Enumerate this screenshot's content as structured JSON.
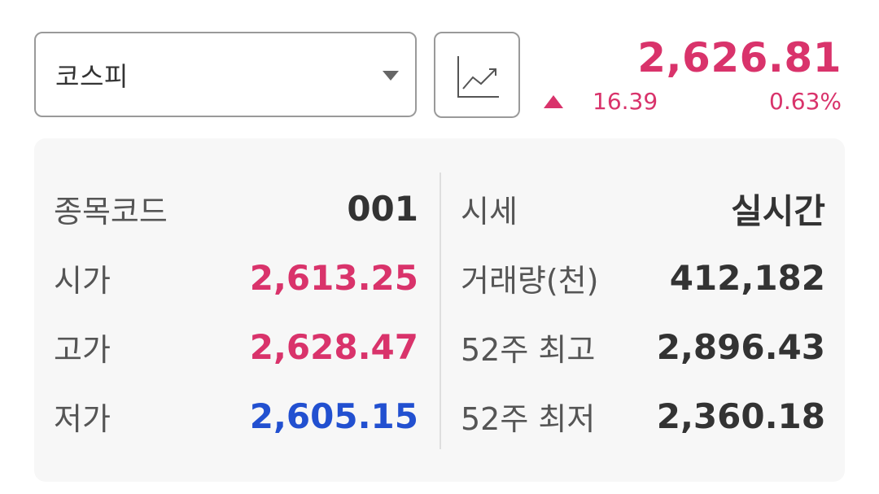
{
  "selector": {
    "selected": "코스피",
    "caret_icon": "caret-down-icon"
  },
  "chart_button": {
    "icon": "line-chart-icon"
  },
  "quote": {
    "price": "2,626.81",
    "direction_icon": "up-triangle-icon",
    "change": "16.39",
    "change_pct": "0.63%",
    "color_up": "#d9336b",
    "color_down": "#2250d0"
  },
  "details": {
    "left": [
      {
        "label": "종목코드",
        "value": "001",
        "tone": "neutral"
      },
      {
        "label": "시가",
        "value": "2,613.25",
        "tone": "up"
      },
      {
        "label": "고가",
        "value": "2,628.47",
        "tone": "up"
      },
      {
        "label": "저가",
        "value": "2,605.15",
        "tone": "down"
      }
    ],
    "right": [
      {
        "label": "시세",
        "value": "실시간",
        "tone": "neutral"
      },
      {
        "label": "거래량(천)",
        "value": "412,182",
        "tone": "neutral"
      },
      {
        "label": "52주 최고",
        "value": "2,896.43",
        "tone": "neutral"
      },
      {
        "label": "52주 최저",
        "value": "2,360.18",
        "tone": "neutral"
      }
    ]
  }
}
